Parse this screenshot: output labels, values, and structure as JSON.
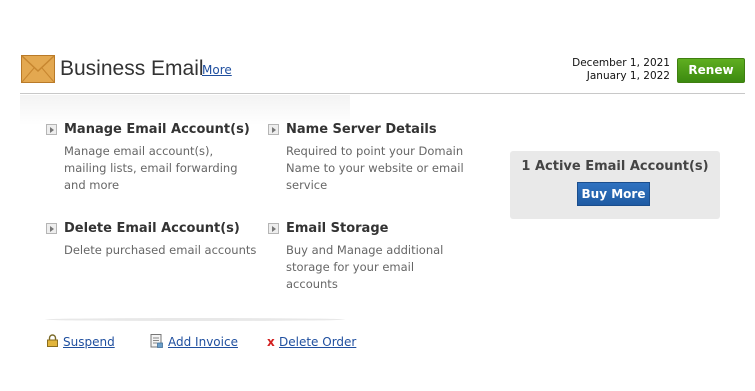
{
  "header": {
    "title": "Business Email",
    "more_label": "More",
    "date_1": "December 1, 2021",
    "date_2": "January 1, 2022",
    "renew_label": "Renew"
  },
  "actions": [
    {
      "title": "Manage Email Account(s)",
      "description": "Manage email account(s), mailing lists, email forwarding and more"
    },
    {
      "title": "Name Server Details",
      "description": "Required to point your Domain Name to your website or email service"
    },
    {
      "title": "Delete Email Account(s)",
      "description": "Delete purchased email accounts"
    },
    {
      "title": "Email Storage",
      "description": "Buy and Manage additional storage for your email accounts"
    }
  ],
  "summary": {
    "active_accounts_text": "1 Active Email Account(s)",
    "buy_more_label": "Buy More"
  },
  "footer": {
    "suspend_label": "Suspend",
    "add_invoice_label": "Add Invoice",
    "delete_order_label": "Delete Order"
  },
  "icons": {
    "mail": "envelope-icon",
    "bullet": "arrow-right-icon",
    "suspend": "lock-icon",
    "invoice": "invoice-icon",
    "delete": "x-icon"
  },
  "colors": {
    "renew": "#4a9a18",
    "buy_more": "#2668b5",
    "link": "#1f4f9f",
    "delete_x": "#d21e1e"
  }
}
